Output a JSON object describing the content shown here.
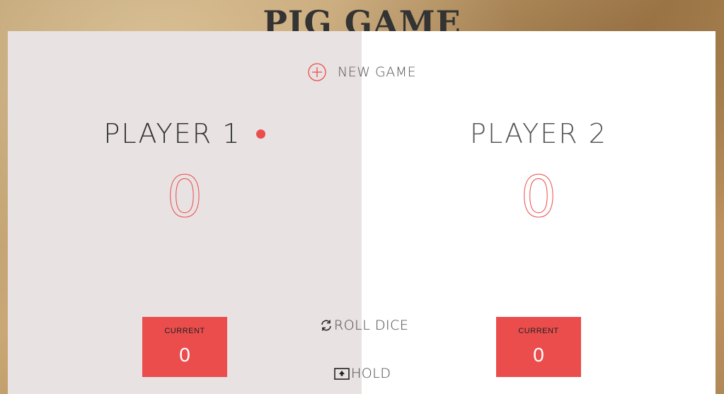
{
  "title": "PIG GAME",
  "colors": {
    "accent": "#eb4d4d",
    "active_panel": "#e8e2e2",
    "inactive_panel": "#ffffff",
    "text": "#333333"
  },
  "controls": {
    "new_game_label": "NEW GAME",
    "new_game_icon": "plus-circle-icon",
    "roll_dice_label": "ROLL DICE",
    "roll_dice_icon": "refresh-icon",
    "hold_label": "HOLD",
    "hold_icon": "upload-box-icon"
  },
  "players": [
    {
      "name": "PLAYER 1",
      "score": "0",
      "current_label": "CURRENT",
      "current_score": "0",
      "active": true
    },
    {
      "name": "PLAYER 2",
      "score": "0",
      "current_label": "CURRENT",
      "current_score": "0",
      "active": false
    }
  ]
}
